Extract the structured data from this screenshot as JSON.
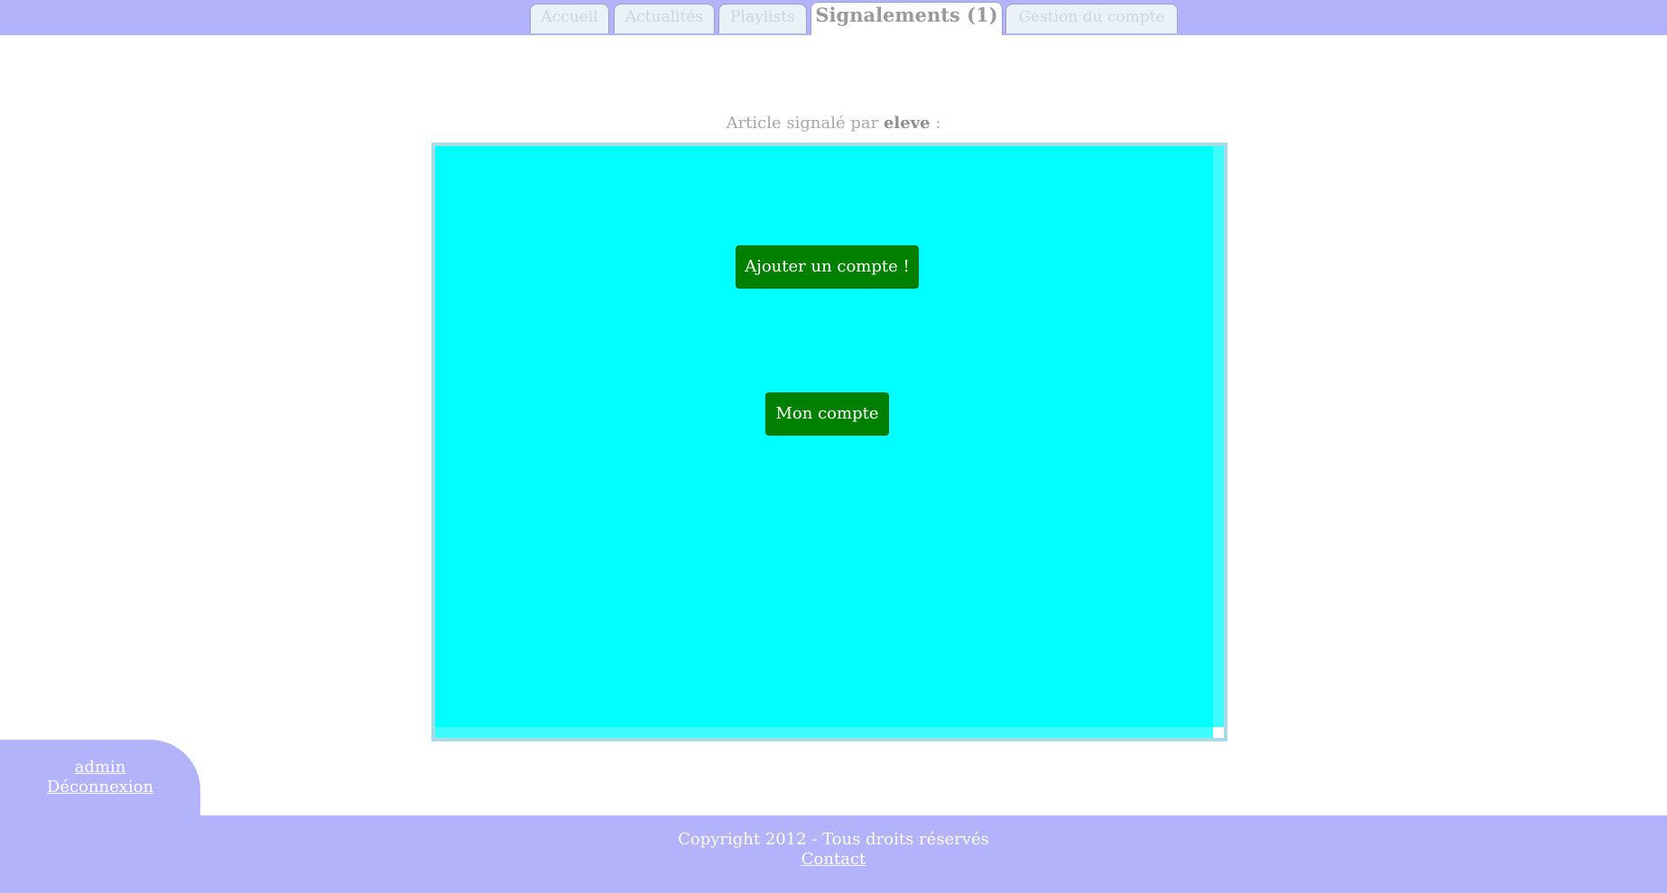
{
  "nav": {
    "tabs": [
      {
        "label": "Accueil",
        "active": false
      },
      {
        "label": "Actualités",
        "active": false
      },
      {
        "label": "Playlists",
        "active": false
      },
      {
        "label": "Signalements (1)",
        "active": true
      },
      {
        "label": "Gestion du compte",
        "active": false
      }
    ]
  },
  "report": {
    "prefix": "Article signalé par",
    "author": "eleve",
    "suffix": ":"
  },
  "article": {
    "buttons": {
      "add_account": "Ajouter un compte !",
      "my_account": "Mon compte"
    }
  },
  "user_panel": {
    "username": "admin",
    "logout": "Déconnexion"
  },
  "footer": {
    "copyright": "Copyright 2012 - Tous droits réservés",
    "contact": "Contact"
  },
  "colors": {
    "bar": "#b3b3fc",
    "frame_background": "#00ffff",
    "button": "#008000"
  }
}
